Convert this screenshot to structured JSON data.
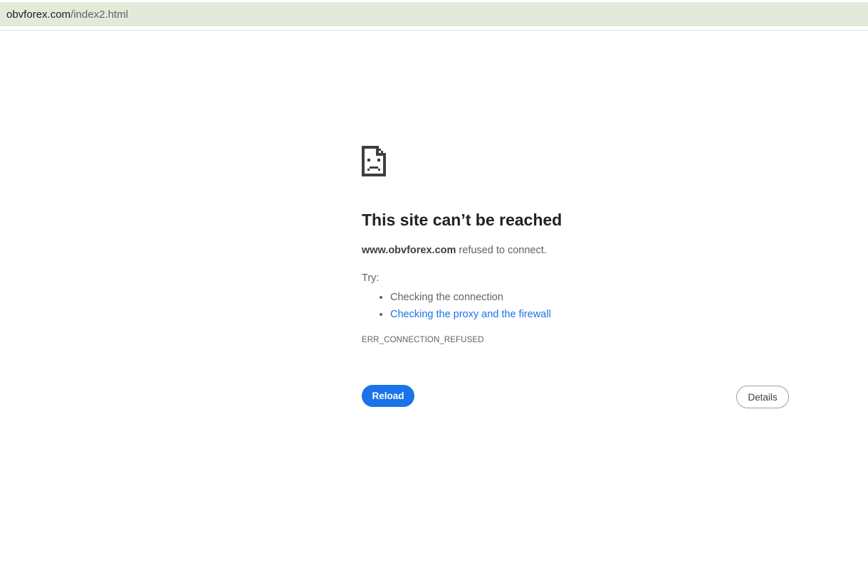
{
  "address_bar": {
    "host": "obvforex.com",
    "path": "/index2.html"
  },
  "error": {
    "icon": "sad-page-icon",
    "title": "This site can’t be reached",
    "host": "www.obvforex.com",
    "message": " refused to connect.",
    "try_label": "Try:",
    "suggestions": [
      {
        "label": "Checking the connection",
        "is_link": false
      },
      {
        "label": "Checking the proxy and the firewall",
        "is_link": true
      }
    ],
    "error_code": "ERR_CONNECTION_REFUSED"
  },
  "buttons": {
    "reload_label": "Reload",
    "details_label": "Details"
  },
  "colors": {
    "address_bar_bg": "#e3ead9",
    "accent": "#1a73e8",
    "title_text": "#202124",
    "body_text": "#5f6368"
  }
}
